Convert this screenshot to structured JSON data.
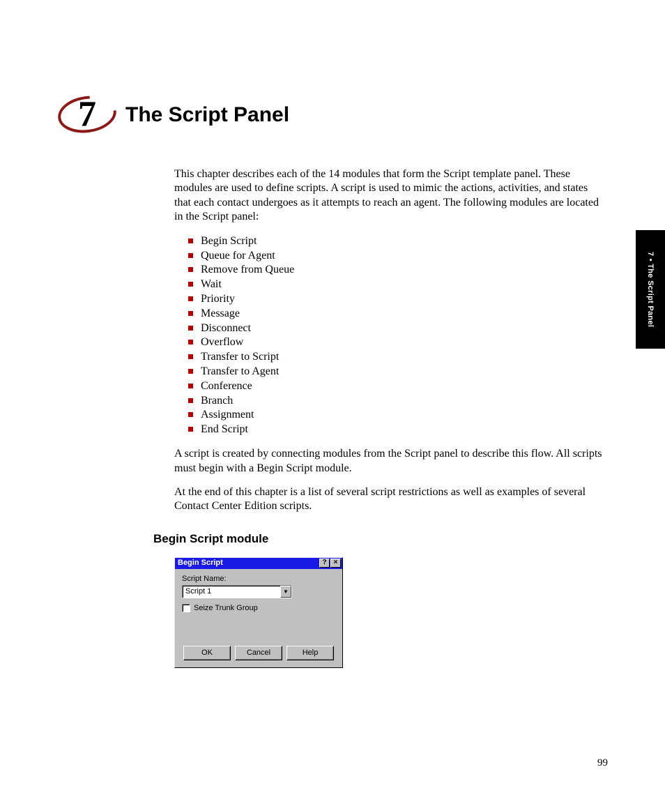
{
  "chapter": {
    "number": "7",
    "title": "The Script Panel"
  },
  "intro": "This chapter describes each of the 14 modules that form the Script template panel. These modules are used to define scripts. A script is used to mimic the actions, activities, and states that each contact undergoes as it attempts to reach an agent. The following modules are located in the Script panel:",
  "modules": [
    "Begin Script",
    "Queue for Agent",
    "Remove from Queue",
    "Wait",
    "Priority",
    "Message",
    "Disconnect",
    "Overflow",
    "Transfer to Script",
    "Transfer to Agent",
    "Conference",
    "Branch",
    "Assignment",
    "End Script"
  ],
  "para2": "A script is created by connecting modules from the Script panel to describe this flow. All scripts must begin with a Begin Script module.",
  "para3": "At the end of this chapter is a list of several script restrictions as well as examples of several Contact Center Edition scripts.",
  "section_heading": "Begin Script module",
  "dialog": {
    "title": "Begin Script",
    "help_char": "?",
    "close_char": "×",
    "label_script_name": "Script Name:",
    "script_value": "Script 1",
    "dropdown_arrow": "▼",
    "checkbox_label": "Seize Trunk Group",
    "btn_ok": "OK",
    "btn_cancel": "Cancel",
    "btn_help": "Help"
  },
  "side_tab": "7 • The Script Panel",
  "page_number": "99"
}
